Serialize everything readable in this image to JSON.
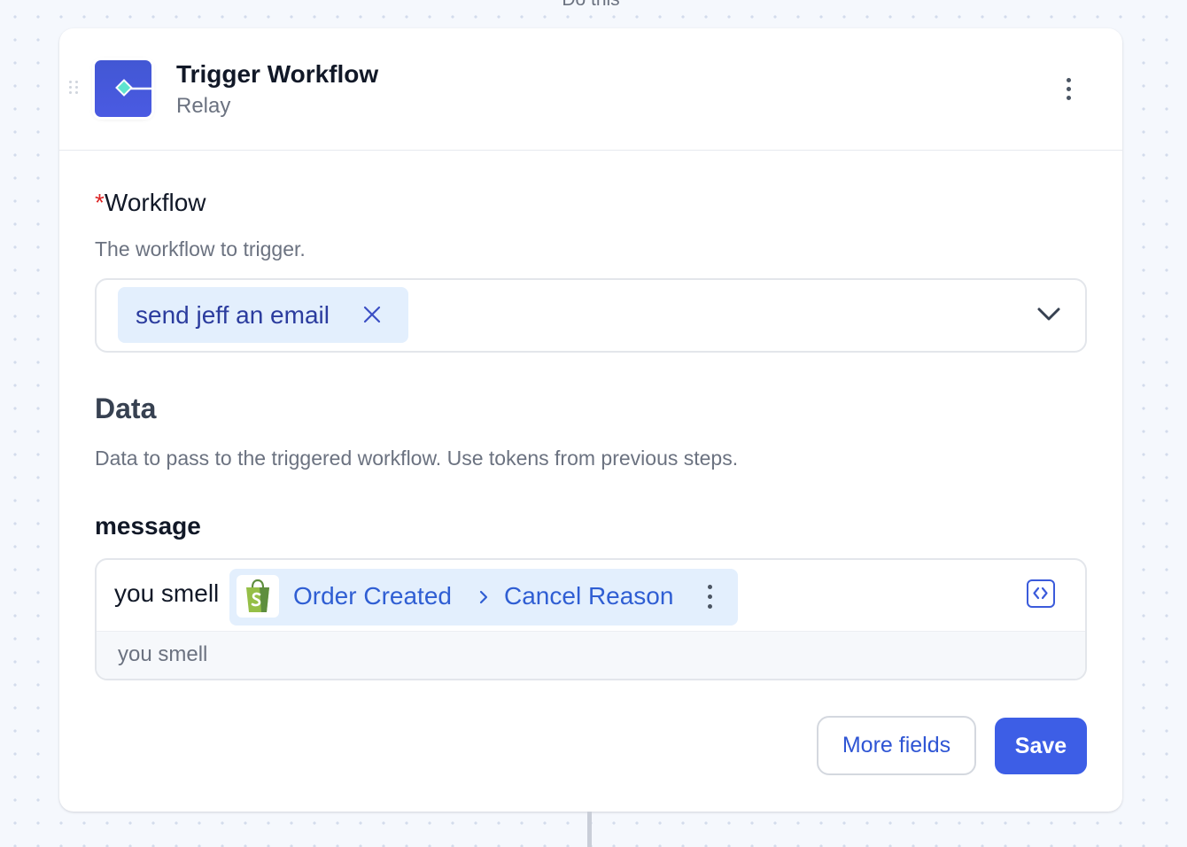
{
  "canvas": {
    "step_label": "Do this"
  },
  "step": {
    "title": "Trigger Workflow",
    "app": "Relay",
    "app_icon": "relay-diamond-icon",
    "menu_icon": "more-vertical-icon"
  },
  "workflow_field": {
    "required_marker": "*",
    "label": "Workflow",
    "description": "The workflow to trigger.",
    "selected_value": "send jeff an email",
    "clear_icon": "close-icon",
    "dropdown_icon": "chevron-down-icon"
  },
  "data_section": {
    "heading": "Data",
    "description": "Data to pass to the triggered workflow. Use tokens from previous steps."
  },
  "message_field": {
    "label": "message",
    "text_before_token": "you smell",
    "token": {
      "app_icon": "shopify-bag-icon",
      "source": "Order Created",
      "separator_icon": "chevron-right-icon",
      "field": "Cancel Reason",
      "menu_icon": "more-vertical-icon"
    },
    "code_toggle_icon": "code-brackets-icon",
    "preview": "you smell"
  },
  "actions": {
    "more_fields_label": "More fields",
    "save_label": "Save"
  },
  "colors": {
    "primary": "#3d5ee6",
    "token_background": "#e3effd",
    "token_text": "#2f5ed3",
    "required": "#dc2626",
    "relay_icon": "#4a5ae2",
    "shopify_green": "#95bf47"
  }
}
